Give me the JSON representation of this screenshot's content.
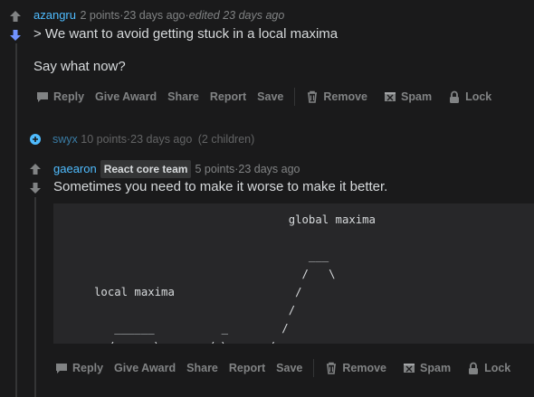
{
  "comment1": {
    "username": "azangru",
    "points": "2 points",
    "time": "23 days ago",
    "edited": "edited 23 days ago",
    "lines": [
      "> We want to avoid getting stuck in a local maxima",
      "Say what now?"
    ]
  },
  "actions": {
    "reply": "Reply",
    "give_award": "Give Award",
    "share": "Share",
    "report": "Report",
    "save": "Save",
    "remove": "Remove",
    "spam": "Spam",
    "lock": "Lock"
  },
  "collapsed": {
    "username": "swyx",
    "points": "10 points",
    "time": "23 days ago",
    "children": "(2 children)"
  },
  "comment2": {
    "username": "gaearon",
    "flair": "React core team",
    "points": "5 points",
    "time": "23 days ago",
    "text": "Sometimes you need to make it worse to make it better.",
    "code": "                                  global maxima\n\n                                     ___\n                                    /   \\\n     local maxima                  /\n                                  /\n        ______          _        /\n       /      \\_______/ \\      /\n------/                  \\___/"
  },
  "colors": {
    "background": "#1a1a1b",
    "username": "#4fbcff",
    "downvote_active": "#7193ff",
    "code_bg": "#272729"
  }
}
